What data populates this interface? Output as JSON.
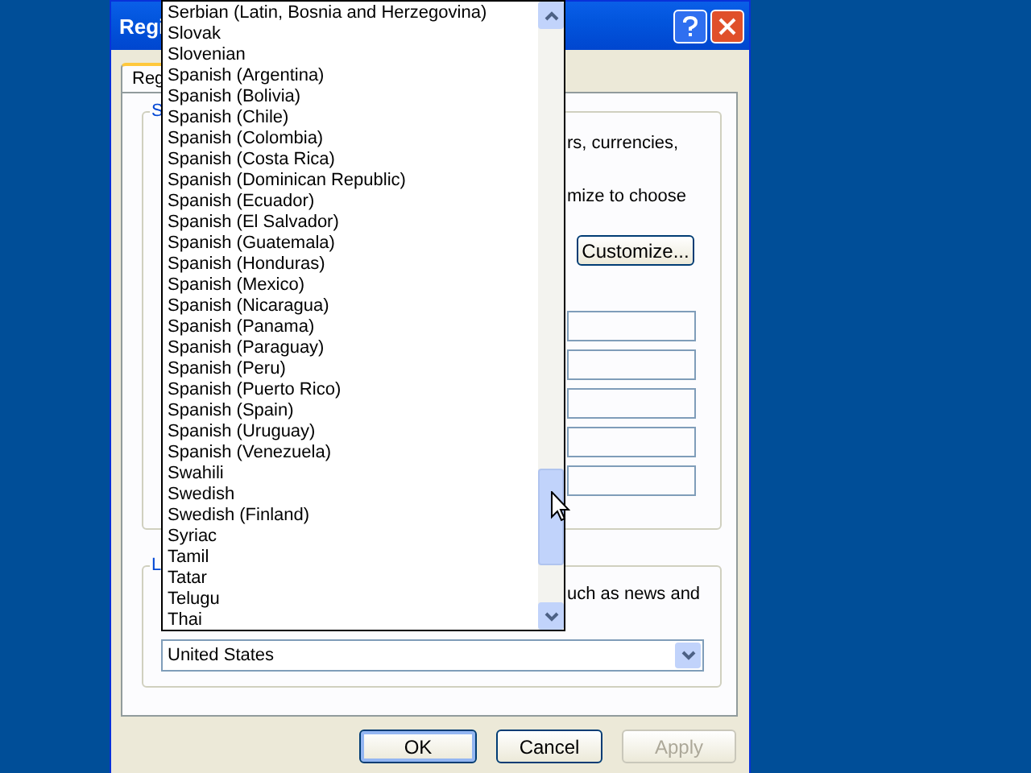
{
  "window": {
    "title": "Regi"
  },
  "tabs": [
    {
      "label": "Reg",
      "selected": true
    }
  ],
  "standards_group": {
    "label": "S",
    "lines": [
      "rs, currencies,",
      "mize to choose"
    ],
    "customize_button": "Customize..."
  },
  "location_group": {
    "label": "L",
    "text": "uch as news and",
    "combo": {
      "value": "United States"
    }
  },
  "dropdown_list": {
    "items": [
      {
        "label": "Serbian (Latin, Bosnia and Herzegovina)"
      },
      {
        "label": "Slovak"
      },
      {
        "label": "Slovenian"
      },
      {
        "label": "Spanish (Argentina)"
      },
      {
        "label": "Spanish (Bolivia)"
      },
      {
        "label": "Spanish (Chile)"
      },
      {
        "label": "Spanish (Colombia)"
      },
      {
        "label": "Spanish (Costa Rica)"
      },
      {
        "label": "Spanish (Dominican Republic)"
      },
      {
        "label": "Spanish (Ecuador)"
      },
      {
        "label": "Spanish (El Salvador)"
      },
      {
        "label": "Spanish (Guatemala)"
      },
      {
        "label": "Spanish (Honduras)"
      },
      {
        "label": "Spanish (Mexico)"
      },
      {
        "label": "Spanish (Nicaragua)"
      },
      {
        "label": "Spanish (Panama)"
      },
      {
        "label": "Spanish (Paraguay)"
      },
      {
        "label": "Spanish (Peru)"
      },
      {
        "label": "Spanish (Puerto Rico)"
      },
      {
        "label": "Spanish (Spain)"
      },
      {
        "label": "Spanish (Uruguay)"
      },
      {
        "label": "Spanish (Venezuela)"
      },
      {
        "label": "Swahili"
      },
      {
        "label": "Swedish"
      },
      {
        "label": "Swedish (Finland)"
      },
      {
        "label": "Syriac"
      },
      {
        "label": "Tamil"
      },
      {
        "label": "Tatar"
      },
      {
        "label": "Telugu"
      },
      {
        "label": "Thai"
      }
    ]
  },
  "buttons": [
    {
      "label": "OK",
      "default": true,
      "disabled": false
    },
    {
      "label": "Cancel",
      "default": false,
      "disabled": false
    },
    {
      "label": "Apply",
      "default": false,
      "disabled": true
    }
  ]
}
